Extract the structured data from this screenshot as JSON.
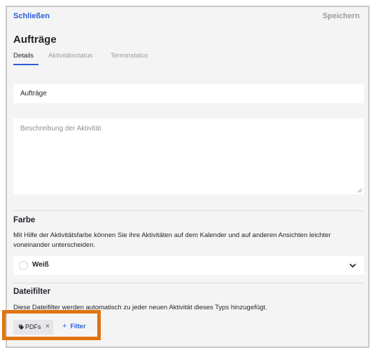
{
  "header": {
    "close_label": "Schließen",
    "save_label": "Speichern"
  },
  "page": {
    "title": "Aufträge"
  },
  "tabs": [
    {
      "label": "Details",
      "active": true
    },
    {
      "label": "Aktivitätsstatus",
      "active": false
    },
    {
      "label": "Terminstatus",
      "active": false
    }
  ],
  "form": {
    "name_value": "Aufträge",
    "description_placeholder": "Beschreibung der Aktivität",
    "description_value": ""
  },
  "color_section": {
    "title": "Farbe",
    "description": "Mit Hilfe der Aktivitätsfarbe können Sie ihre Aktivitäten auf dem Kalender und auf anderen Ansichten leichter voneinander unterscheiden.",
    "selected_color_label": "Weiß",
    "selected_color_hex": "#ffffff"
  },
  "file_filter_section": {
    "title": "Dateifilter",
    "description": "Diese Dateifilter werden automatisch zu jeder neuen Aktivität dieses Typs hinzugefügt.",
    "filters": [
      {
        "label": "PDFs",
        "icon": "tag-icon",
        "remove_glyph": "×"
      }
    ],
    "add_filter_plus": "+",
    "add_filter_label": "Filter"
  },
  "colors": {
    "accent": "#2b5fd9",
    "muted_text": "#9a9ca2",
    "highlight": "#e0740f",
    "background": "#f4f4f5"
  }
}
